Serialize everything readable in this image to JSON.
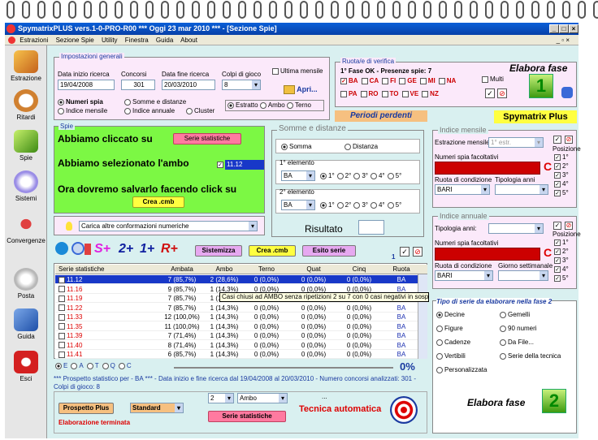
{
  "window": {
    "title": "SpymatrixPLUS vers.1-0-PRO-R00   ***   Oggi 23 mar 2010   ***   - [Sezione Spie]"
  },
  "menu": [
    "Estrazioni",
    "Sezione Spie",
    "Utility",
    "Finestra",
    "Guida",
    "About"
  ],
  "sidebar": [
    {
      "label": "Estrazione",
      "icon": "pencil-icon"
    },
    {
      "label": "Ritardi",
      "icon": "clock-icon"
    },
    {
      "label": "Spie",
      "icon": "flashlight-icon"
    },
    {
      "label": "Sistemi",
      "icon": "bulb-icon"
    },
    {
      "label": "Convergenze",
      "icon": "pyramid-icon"
    },
    {
      "label": "Posta",
      "icon": "coin-icon"
    },
    {
      "label": "Guida",
      "icon": "book-icon"
    },
    {
      "label": "Esci",
      "icon": "power-icon"
    }
  ],
  "general": {
    "title": "Impostazioni generali",
    "data_inizio_label": "Data inizio ricerca",
    "data_inizio": "19/04/2008",
    "concorsi_label": "Concorsi",
    "concorsi": "301",
    "data_fine_label": "Data fine ricerca",
    "data_fine": "20/03/2010",
    "colpi_label": "Colpi di gioco",
    "colpi": "8",
    "ultima_mensile": "Ultima mensile",
    "apri": "Apri...",
    "numeri_spia": "Numeri spia",
    "indice_mensile": "Indice mensile",
    "somme_distanze": "Somme e distanze",
    "indice_annuale": "Indice annuale",
    "cluster": "Cluster",
    "estratto": "Estratto",
    "ambo": "Ambo",
    "terno": "Terno"
  },
  "ruote": {
    "title": "Ruota/e di verifica",
    "status": "1° Fase OK - Presenze spie: 7",
    "elabora": "Elabora fase",
    "list1": [
      "BA",
      "CA",
      "FI",
      "GE",
      "MI",
      "NA"
    ],
    "list2": [
      "PA",
      "RO",
      "TO",
      "VE",
      "NZ"
    ],
    "multi": "Multi",
    "phase": "1"
  },
  "periodi": "Periodi perdenti",
  "brand": "Spymatrix Plus",
  "spie": {
    "title": "Spie",
    "line1": "Abbiamo cliccato su",
    "btn_serie": "Serie statistiche",
    "line2": "Abbiamo selezionato l'ambo",
    "selected": "11.12",
    "line3": "Ora dovremo salvarlo facendo click su",
    "btn_crea": "Crea .cmb",
    "carica": "Carica altre conformazioni numeriche"
  },
  "somme": {
    "title": "Somme e distanze",
    "somma": "Somma",
    "distanza": "Distanza",
    "el1": "1° elemento",
    "el2": "2° elemento",
    "ruota": "BA",
    "pos": [
      "1°",
      "2°",
      "3°",
      "4°",
      "5°"
    ],
    "risultato": "Risultato"
  },
  "mensile": {
    "title": "Indice mensile",
    "estr_label": "Estrazione mensile:",
    "estr_val": "1° estr.",
    "posizione": "Posizione",
    "numeri_label": "Numeri spia facoltativi",
    "ruota_cond": "Ruota di condizione",
    "tipologia": "Tipologia anni",
    "ruota": "BARI",
    "pos": [
      "1°",
      "2°",
      "3°",
      "4°",
      "5°"
    ]
  },
  "annuale": {
    "title": "Indice annuale",
    "tip_label": "Tipologia anni:",
    "posizione": "Posizione",
    "numeri_label": "Numeri spia facoltativi",
    "ruota_cond": "Ruota di condizione",
    "giorno": "Giorno settimanale",
    "ruota": "BARI",
    "pos": [
      "1°",
      "2°",
      "3°",
      "4°",
      "5°"
    ]
  },
  "toolbar": {
    "splus": "S+",
    "two": "2+",
    "one": "1+",
    "rplus": "R+",
    "sistemizza": "Sistemizza",
    "crea": "Crea .cmb",
    "esito": "Esito serie",
    "count": "1"
  },
  "table": {
    "headers": [
      "Serie statistiche",
      "Ambata",
      "Ambo",
      "Terno",
      "Quat",
      "Cinq",
      "Ruota"
    ],
    "rows": [
      [
        "11.12",
        "7 (85,7%)",
        "2 (28,6%)",
        "0 (0,0%)",
        "0 (0,0%)",
        "0 (0,0%)",
        "BA"
      ],
      [
        "11.16",
        "9 (85,7%)",
        "1 (14,3%)",
        "0 (0,0%)",
        "0 (0,0%)",
        "0 (0,0%)",
        "BA"
      ],
      [
        "11.19",
        "7 (85,7%)",
        "1 (14,3%)",
        "0 (0,0%)",
        "0 (0,0%)",
        "0 (0,0%)",
        "BA"
      ],
      [
        "11.22",
        "7 (85,7%)",
        "1 (14,3%)",
        "0 (0,0%)",
        "0 (0,0%)",
        "0 (0,0%)",
        "BA"
      ],
      [
        "11.33",
        "12 (100,0%)",
        "1 (14,3%)",
        "0 (0,0%)",
        "0 (0,0%)",
        "0 (0,0%)",
        "BA"
      ],
      [
        "11.35",
        "11 (100,0%)",
        "1 (14,3%)",
        "0 (0,0%)",
        "0 (0,0%)",
        "0 (0,0%)",
        "BA"
      ],
      [
        "11.39",
        "7 (71,4%)",
        "1 (14,3%)",
        "0 (0,0%)",
        "0 (0,0%)",
        "0 (0,0%)",
        "BA"
      ],
      [
        "11.40",
        "8 (71,4%)",
        "1 (14,3%)",
        "0 (0,0%)",
        "0 (0,0%)",
        "0 (0,0%)",
        "BA"
      ],
      [
        "11.41",
        "6 (85,7%)",
        "1 (14,3%)",
        "0 (0,0%)",
        "0 (0,0%)",
        "0 (0,0%)",
        "BA"
      ]
    ],
    "tooltip": "Casi chiusi ad AMBO senza ripetizioni 2 su 7 con 0 casi negativi in sospeso",
    "filters": [
      "E",
      "A",
      "T",
      "Q",
      "C"
    ],
    "progress": "0%"
  },
  "prospetto": "*** Prospetto statistico per  - BA ***  - Data inizio e fine ricerca dal 19/04/2008 al 20/03/2010 - Numero concorsi analizzati: 301  - Colpi di gioco: 8",
  "bottom": {
    "prospetto_plus": "Prospetto Plus",
    "standard": "Standard",
    "terminata": "Elaborazione terminata",
    "num": "2",
    "ambo": "Ambo",
    "dots": "...",
    "serie": "Serie statistiche",
    "tecnica": "Tecnica automatica"
  },
  "fase2": {
    "title": "Tipo di serie da elaborare nella fase 2",
    "options": [
      [
        "Decine",
        "Gemelli"
      ],
      [
        "Figure",
        "90 numeri"
      ],
      [
        "Cadenze",
        "Da File..."
      ],
      [
        "Vertibili",
        "Serie della tecnica"
      ],
      [
        "Personalizzata",
        ""
      ]
    ],
    "elabora": "Elabora fase",
    "phase": "2"
  }
}
